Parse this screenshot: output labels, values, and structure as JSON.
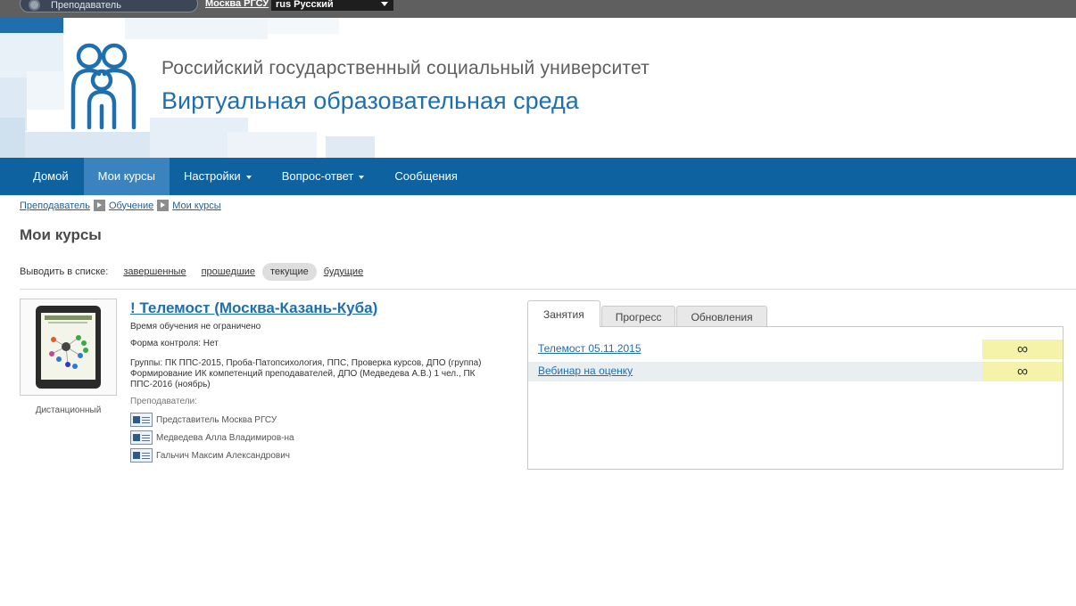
{
  "topbar": {
    "role": "Преподаватель",
    "city": "Москва РГСУ",
    "language": "rus Русский"
  },
  "header": {
    "university": "Российский государственный социальный университет",
    "environment": "Виртуальная образовательная среда"
  },
  "nav": {
    "home": "Домой",
    "my_courses": "Мои курсы",
    "settings": "Настройки",
    "qa": "Вопрос-ответ",
    "messages": "Сообщения"
  },
  "breadcrumb": [
    "Преподаватель",
    "Обучение",
    "Мои курсы"
  ],
  "page_title": "Мои курсы",
  "filter": {
    "label": "Выводить в списке:",
    "options": [
      "завершенные",
      "прошедшие",
      "текущие",
      "будущие"
    ],
    "selected": "текущие"
  },
  "course": {
    "title": "! Телемост (Москва-Казань-Куба)",
    "type": "Дистанционный",
    "duration": "Время обучения не ограничено",
    "control_form": "Форма контроля: Нет",
    "groups": "Группы: ПК ППС-2015, Проба-Патопсихология, ППС, Проверка курсов, ДПО (группа) Формирование ИК компетенций преподавателей, ДПО (Медведева А.В.) 1 чел., ПК ППС-2016 (ноябрь)",
    "teachers_label": "Преподаватели:",
    "teachers": [
      "Представитель Москва РГСУ",
      "Медведева Алла Владимиров-на",
      "Гальчич Максим Александрович"
    ]
  },
  "panel": {
    "tabs": [
      "Занятия",
      "Прогресс",
      "Обновления"
    ],
    "active_tab": "Занятия",
    "lessons": [
      {
        "title": "Телемост 05.11.2015",
        "limit": "∞"
      },
      {
        "title": "Вебинар на оценку",
        "limit": "∞"
      }
    ]
  },
  "colors": {
    "nav": "#0f62a0",
    "nav_active": "#3a83be",
    "link": "#1f6fae",
    "highlight": "#f4f3a9"
  }
}
